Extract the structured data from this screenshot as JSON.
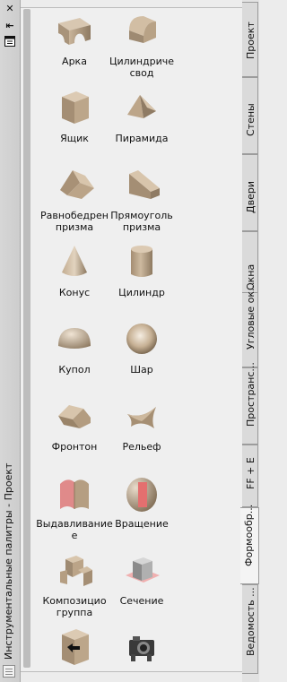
{
  "window": {
    "title": "Инструментальные палитры - Проект",
    "close_icon": "close-icon",
    "autohide_icon": "autohide-icon",
    "properties_icon": "properties-icon"
  },
  "tools": [
    {
      "label1": "Арка",
      "label2": "",
      "icon": "arch-icon"
    },
    {
      "label1": "Цилиндриче",
      "label2": "свод",
      "icon": "cylinder-vault-icon"
    },
    {
      "label1": "Ящик",
      "label2": "",
      "icon": "box-icon"
    },
    {
      "label1": "Пирамида",
      "label2": "",
      "icon": "pyramid-icon"
    },
    {
      "label1": "Равнобедрен",
      "label2": "призма",
      "icon": "isosceles-prism-icon"
    },
    {
      "label1": "Прямоуголь",
      "label2": "призма",
      "icon": "right-prism-icon"
    },
    {
      "label1": "Конус",
      "label2": "",
      "icon": "cone-icon"
    },
    {
      "label1": "Цилиндр",
      "label2": "",
      "icon": "cylinder-icon"
    },
    {
      "label1": "Купол",
      "label2": "",
      "icon": "dome-icon"
    },
    {
      "label1": "Шар",
      "label2": "",
      "icon": "sphere-icon"
    },
    {
      "label1": "Фронтон",
      "label2": "",
      "icon": "gable-icon"
    },
    {
      "label1": "Рельеф",
      "label2": "",
      "icon": "relief-icon"
    },
    {
      "label1": "Выдавливание",
      "label2": "е",
      "icon": "extrude-icon"
    },
    {
      "label1": "Вращение",
      "label2": "",
      "icon": "revolve-icon"
    },
    {
      "label1": "Композицио",
      "label2": "группа",
      "icon": "composition-group-icon"
    },
    {
      "label1": "Сечение",
      "label2": "",
      "icon": "section-icon"
    },
    {
      "label1": "",
      "label2": "",
      "icon": "insert-box-icon"
    },
    {
      "label1": "",
      "label2": "",
      "icon": "camera-icon"
    }
  ],
  "tabs": [
    {
      "label": "Проект",
      "active": false
    },
    {
      "label": "Стены",
      "active": false
    },
    {
      "label": "Двери",
      "active": false
    },
    {
      "label": "Окна",
      "active": false
    },
    {
      "label": "Угловые ок...",
      "active": false
    },
    {
      "label": "Пространс...",
      "active": false
    },
    {
      "label": "FF + E",
      "active": false
    },
    {
      "label": "Формообр...",
      "active": true
    },
    {
      "label": "Ведомость ...",
      "active": false
    }
  ]
}
